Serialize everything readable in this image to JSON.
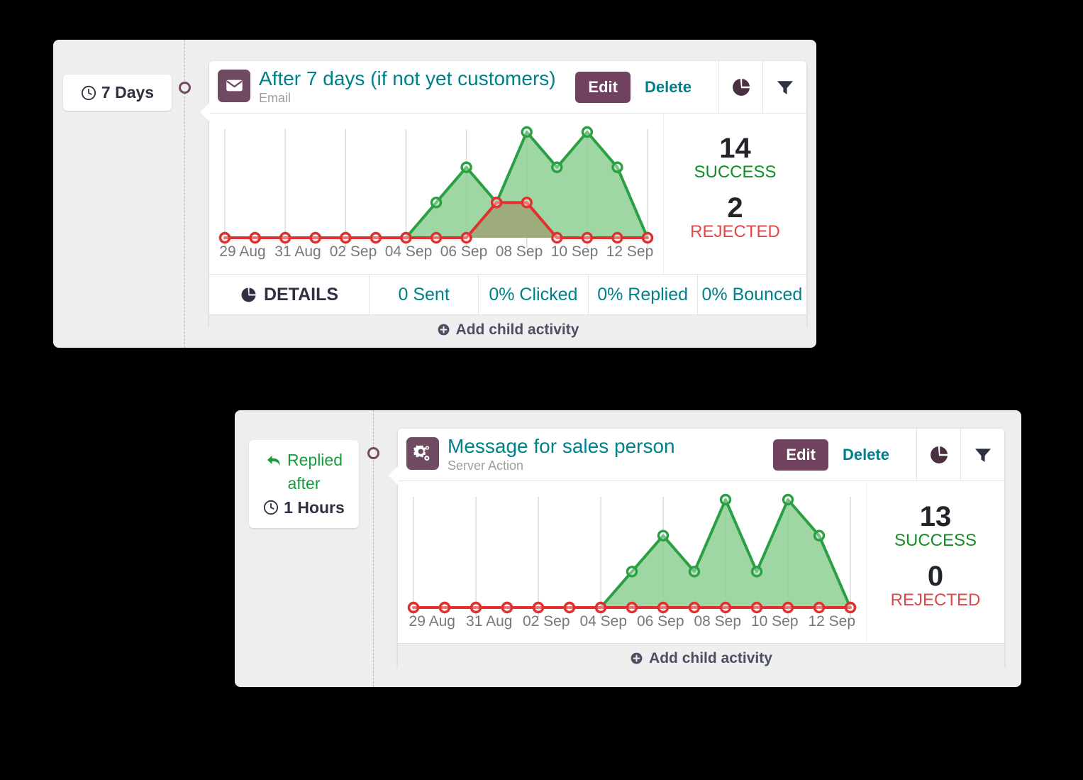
{
  "blocks": [
    {
      "trigger": {
        "icon": "clock-icon",
        "label": "7 Days"
      },
      "card": {
        "icon": "envelope-icon",
        "title": "After 7 days (if not yet customers)",
        "subtitle": "Email",
        "edit_label": "Edit",
        "delete_label": "Delete",
        "pie_icon": "pie-chart-icon",
        "filter_icon": "filter-icon",
        "stats": {
          "success_value": "14",
          "success_label": "SUCCESS",
          "rejected_value": "2",
          "rejected_label": "REJECTED"
        },
        "details_label": "DETAILS",
        "metrics": [
          {
            "label": "0 Sent"
          },
          {
            "label": "0% Clicked"
          },
          {
            "label": "0% Replied"
          },
          {
            "label": "0% Bounced"
          }
        ],
        "add_child_label": "Add child activity"
      }
    },
    {
      "trigger": {
        "icon": "reply-icon",
        "label_line1": "Replied",
        "label_line2": "after",
        "clock_icon": "clock-icon",
        "label_line3": "1 Hours"
      },
      "card": {
        "icon": "cogs-icon",
        "title": "Message for sales person",
        "subtitle": "Server Action",
        "edit_label": "Edit",
        "delete_label": "Delete",
        "pie_icon": "pie-chart-icon",
        "filter_icon": "filter-icon",
        "stats": {
          "success_value": "13",
          "success_label": "SUCCESS",
          "rejected_value": "0",
          "rejected_label": "REJECTED"
        },
        "add_child_label": "Add child activity"
      }
    }
  ],
  "colors": {
    "success": "#2aa043",
    "success_fill": "#8dcf94",
    "rejected": "#e03030",
    "teal": "#00808a",
    "purple": "#6f4a61",
    "edit_purple": "#71425f",
    "panel_bg": "#eeeeee"
  },
  "chart_data": [
    {
      "type": "area",
      "title": "After 7 days (if not yet customers)",
      "xlabel": "",
      "ylabel": "",
      "grid": true,
      "legend": "none",
      "x": [
        "29 Aug",
        "30 Aug",
        "31 Aug",
        "01 Sep",
        "02 Sep",
        "03 Sep",
        "04 Sep",
        "05 Sep",
        "06 Sep",
        "07 Sep",
        "08 Sep",
        "09 Sep",
        "10 Sep",
        "11 Sep",
        "12 Sep"
      ],
      "tick_labels": [
        "29 Aug",
        "31 Aug",
        "02 Sep",
        "04 Sep",
        "06 Sep",
        "08 Sep",
        "10 Sep",
        "12 Sep"
      ],
      "ylim": [
        0,
        3
      ],
      "series": [
        {
          "name": "SUCCESS",
          "color": "#2aa043",
          "values": [
            0,
            0,
            0,
            0,
            0,
            0,
            0,
            1,
            2,
            1,
            3,
            2,
            3,
            2,
            0
          ]
        },
        {
          "name": "REJECTED",
          "color": "#e03030",
          "values": [
            0,
            0,
            0,
            0,
            0,
            0,
            0,
            0,
            0,
            1,
            1,
            0,
            0,
            0,
            0
          ]
        }
      ]
    },
    {
      "type": "area",
      "title": "Message for sales person",
      "xlabel": "",
      "ylabel": "",
      "grid": true,
      "legend": "none",
      "x": [
        "29 Aug",
        "30 Aug",
        "31 Aug",
        "01 Sep",
        "02 Sep",
        "03 Sep",
        "04 Sep",
        "05 Sep",
        "06 Sep",
        "07 Sep",
        "08 Sep",
        "09 Sep",
        "10 Sep",
        "11 Sep",
        "12 Sep"
      ],
      "tick_labels": [
        "29 Aug",
        "31 Aug",
        "02 Sep",
        "04 Sep",
        "06 Sep",
        "08 Sep",
        "10 Sep",
        "12 Sep"
      ],
      "ylim": [
        0,
        3
      ],
      "series": [
        {
          "name": "SUCCESS",
          "color": "#2aa043",
          "values": [
            0,
            0,
            0,
            0,
            0,
            0,
            0,
            1,
            2,
            1,
            3,
            1,
            3,
            2,
            0
          ]
        },
        {
          "name": "REJECTED",
          "color": "#e03030",
          "values": [
            0,
            0,
            0,
            0,
            0,
            0,
            0,
            0,
            0,
            0,
            0,
            0,
            0,
            0,
            0
          ]
        }
      ]
    }
  ]
}
